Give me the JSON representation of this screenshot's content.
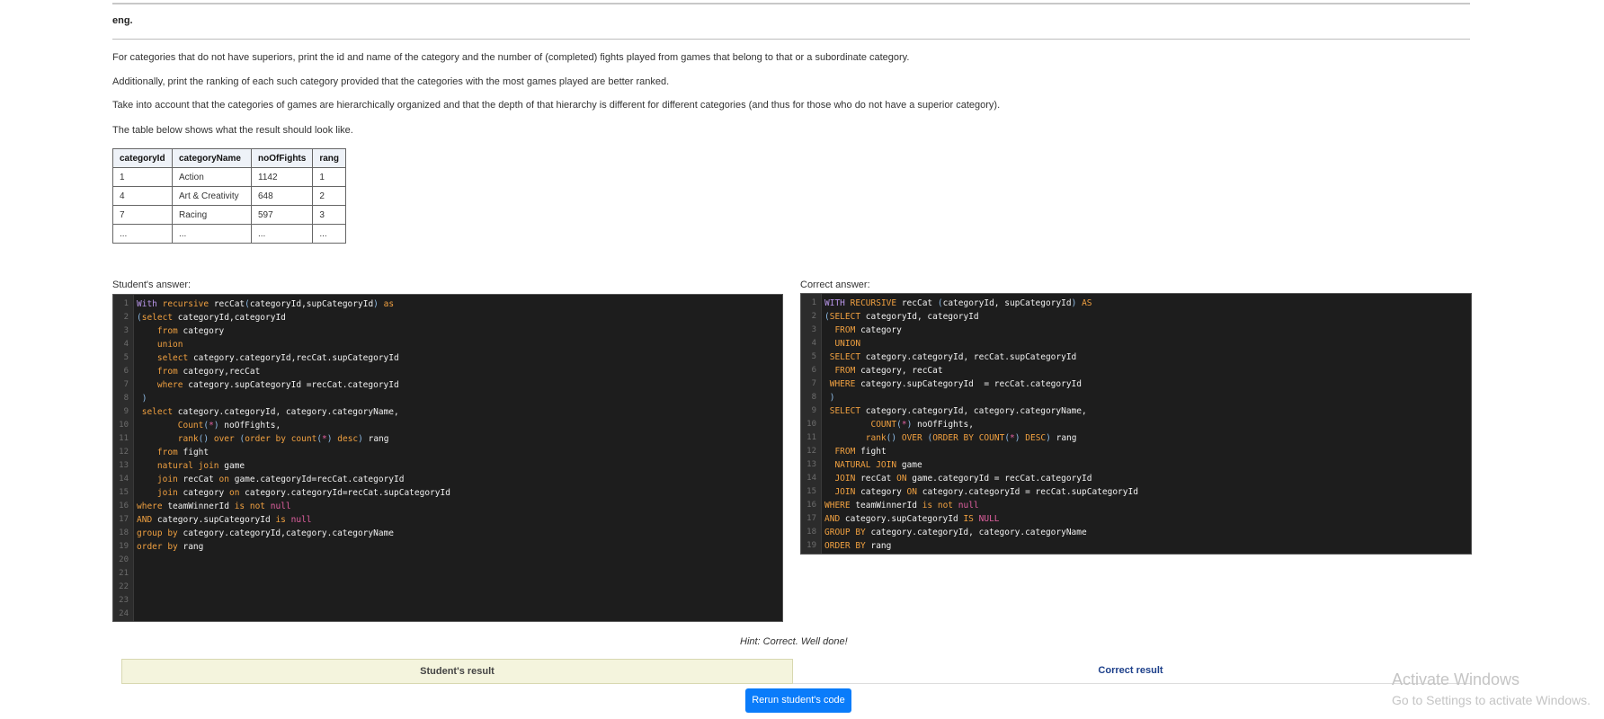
{
  "lang": "eng.",
  "task": {
    "p1": "For categories that do not have superiors, print the id and name of the category and the number of (completed) fights played from games that belong to that or a subordinate category.",
    "p2": "Additionally, print the ranking of each such category provided that the categories with the most games played are better ranked.",
    "p3": "Take into account that the categories of games are hierarchically organized and that the depth of that hierarchy is different for different categories (and thus for those who do not have a superior category).",
    "p4": "The table below shows what the result should look like."
  },
  "result_table": {
    "headers": [
      "categoryId",
      "categoryName",
      "noOfFights",
      "rang"
    ],
    "rows": [
      [
        "1",
        "Action",
        "1142",
        "1"
      ],
      [
        "4",
        "Art & Creativity",
        "648",
        "2"
      ],
      [
        "7",
        "Racing",
        "597",
        "3"
      ],
      [
        "...",
        "...",
        "...",
        "..."
      ]
    ]
  },
  "student": {
    "label": "Student's answer:",
    "code": [
      "<span class=\"ks\">With</span> <span class=\"k\">recursive</span> recCat<span class=\"f\">(</span>categoryId,supCategoryId<span class=\"f\">)</span> <span class=\"k\">as</span>",
      "<span class=\"f\">(</span><span class=\"k\">select</span> categoryId,categoryId",
      "    <span class=\"k\">from</span> category",
      "    <span class=\"k\">union</span>",
      "    <span class=\"k\">select</span> category.categoryId,recCat.supCategoryId",
      "    <span class=\"k\">from</span> category,recCat",
      "    <span class=\"k\">where</span> category.supCategoryId =recCat.categoryId",
      " <span class=\"f\">)</span>",
      " <span class=\"k\">select</span> category.categoryId, category.categoryName,",
      "        <span class=\"k\">Count</span><span class=\"f\">(</span><span class=\"s\">*</span><span class=\"f\">)</span> noOfFights,",
      "        <span class=\"k\">rank</span><span class=\"f\">()</span> <span class=\"k\">over</span> <span class=\"f\">(</span><span class=\"k\">order by</span> <span class=\"k\">count</span><span class=\"f\">(</span><span class=\"s\">*</span><span class=\"f\">)</span> <span class=\"k\">desc</span><span class=\"f\">)</span> rang",
      "    <span class=\"k\">from</span> fight",
      "    <span class=\"k\">natural join</span> game",
      "    <span class=\"k\">join</span> recCat <span class=\"k\">on</span> game.categoryId=recCat.categoryId",
      "    <span class=\"k\">join</span> category <span class=\"k\">on</span> category.categoryId=recCat.supCategoryId",
      "<span class=\"k\">where</span> teamWinnerId <span class=\"k\">is not</span> <span class=\"s\">null</span>",
      "<span class=\"k\">AND</span> category.supCategoryId <span class=\"k\">is</span> <span class=\"s\">null</span>",
      "<span class=\"k\">group by</span> category.categoryId,category.categoryName",
      "<span class=\"k\">order by</span> rang",
      "",
      "",
      "",
      "",
      ""
    ]
  },
  "correct": {
    "label": "Correct answer:",
    "code": [
      "<span class=\"ks\">WITH</span> <span class=\"k\">RECURSIVE</span> recCat <span class=\"f\">(</span>categoryId, supCategoryId<span class=\"f\">)</span> <span class=\"k\">AS</span>",
      "<span class=\"f\">(</span><span class=\"k\">SELECT</span> categoryId, categoryId",
      "  <span class=\"k\">FROM</span> category",
      "  <span class=\"k\">UNION</span>",
      " <span class=\"k\">SELECT</span> category.categoryId, recCat.supCategoryId",
      "  <span class=\"k\">FROM</span> category, recCat",
      " <span class=\"k\">WHERE</span> category.supCategoryId  = recCat.categoryId",
      " <span class=\"f\">)</span>",
      " <span class=\"k\">SELECT</span> category.categoryId, category.categoryName,",
      "         <span class=\"k\">COUNT</span><span class=\"f\">(</span><span class=\"s\">*</span><span class=\"f\">)</span> noOfFights,",
      "        <span class=\"k\">rank</span><span class=\"f\">()</span> <span class=\"k\">OVER</span> <span class=\"f\">(</span><span class=\"k\">ORDER BY</span> <span class=\"k\">COUNT</span><span class=\"f\">(</span><span class=\"s\">*</span><span class=\"f\">)</span> <span class=\"k\">DESC</span><span class=\"f\">)</span> rang",
      "  <span class=\"k\">FROM</span> fight",
      "  <span class=\"k\">NATURAL JOIN</span> game",
      "  <span class=\"k\">JOIN</span> recCat <span class=\"k\">ON</span> game.categoryId = recCat.categoryId",
      "  <span class=\"k\">JOIN</span> category <span class=\"k\">ON</span> category.categoryId = recCat.supCategoryId",
      "<span class=\"k\">WHERE</span> teamWinnerId <span class=\"k\">is not</span> <span class=\"s\">null</span>",
      "<span class=\"k\">AND</span> category.supCategoryId <span class=\"k\">IS</span> <span class=\"s\">NULL</span>",
      "<span class=\"k\">GROUP BY</span> category.categoryId, category.categoryName",
      "<span class=\"k\">ORDER BY</span> rang"
    ]
  },
  "hint": "Hint: Correct. Well done!",
  "tabs": {
    "student": "Student's result",
    "correct": "Correct result"
  },
  "rerun_label": "Rerun student's code",
  "watermark": {
    "title": "Activate Windows",
    "subtitle": "Go to Settings to activate Windows."
  },
  "colors": {
    "editor_bg": "#1d1d1d",
    "keyword": "#f0a040",
    "null_literal": "#e060a0",
    "button": "#0a7cfa",
    "tab_active": "#f4f4dd",
    "link": "#1c3f8a"
  }
}
